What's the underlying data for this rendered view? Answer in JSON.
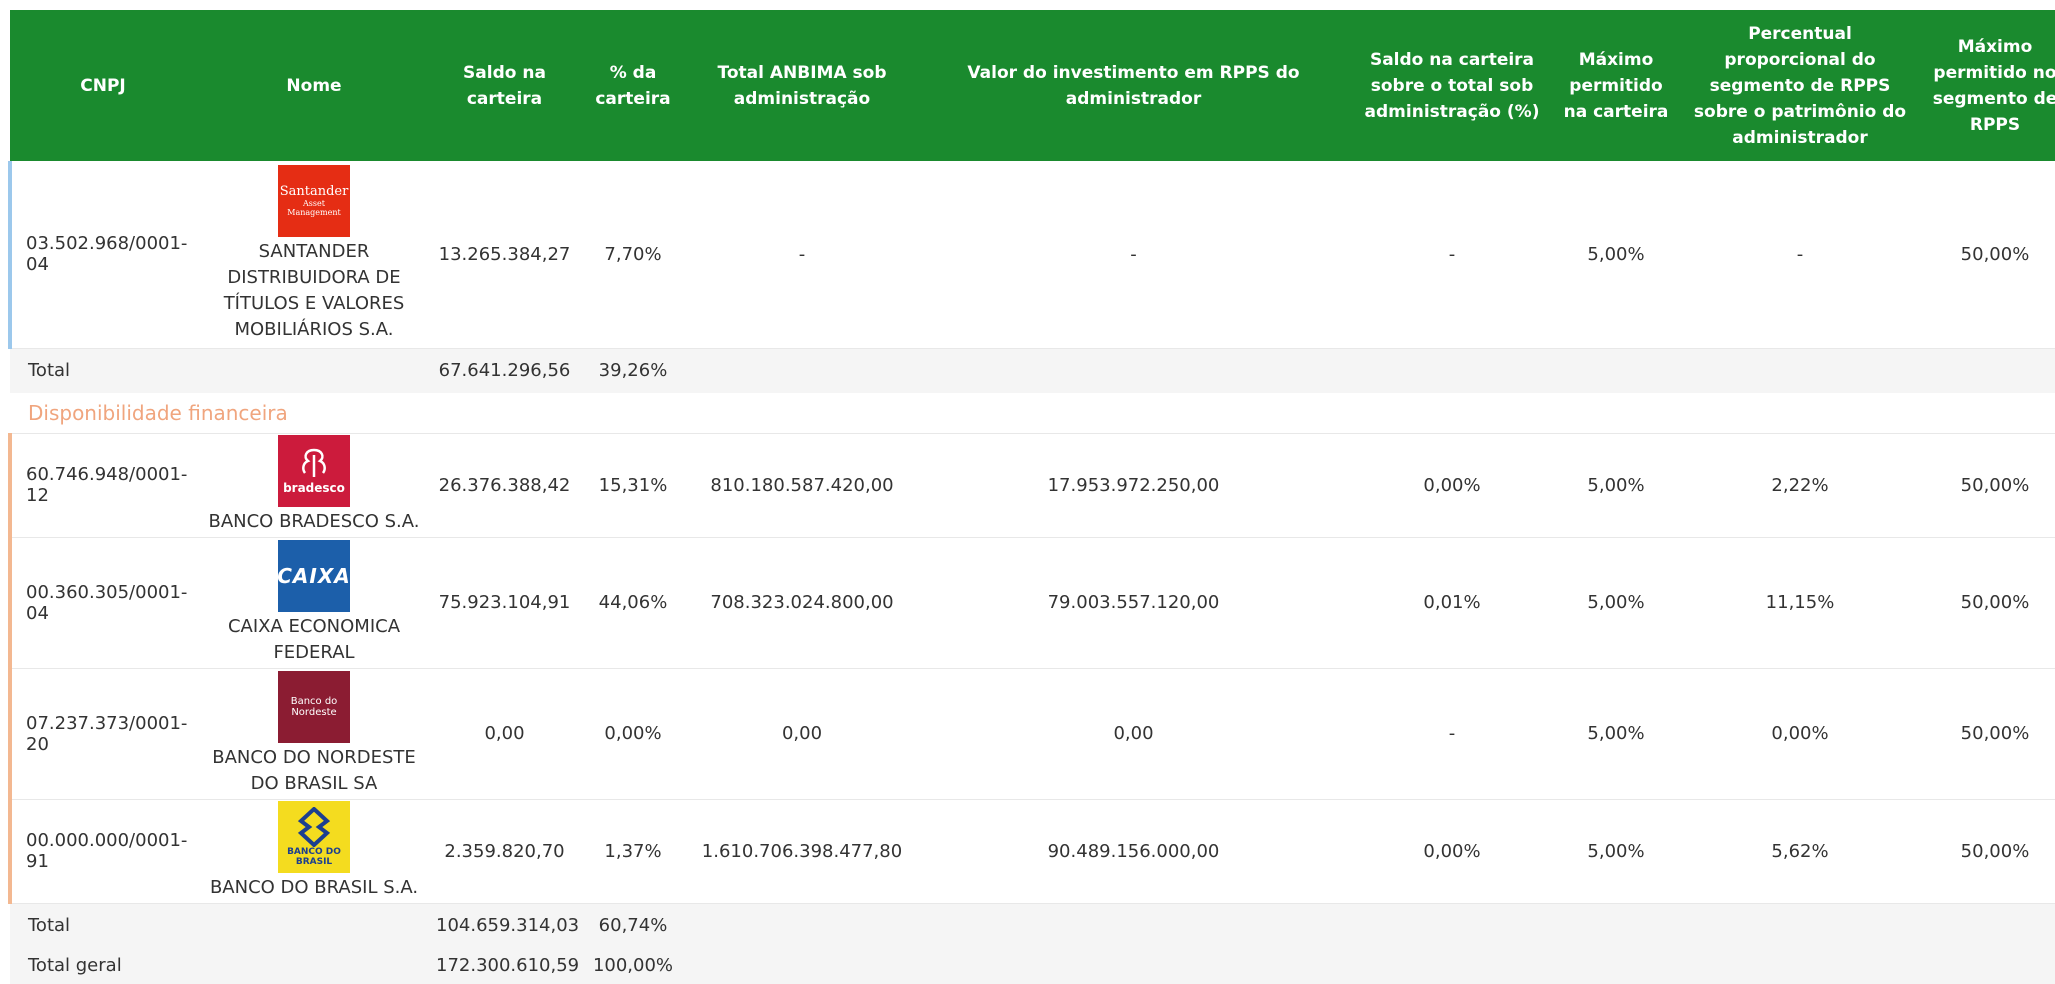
{
  "headers": [
    "CNPJ",
    "Nome",
    "Saldo na carteira",
    "% da carteira",
    "Total ANBIMA sob administração",
    "Valor do investimento em RPPS do administrador",
    "Saldo na carteira sobre o total sob administração (%)",
    "Máximo permitido na carteira",
    "Percentual proporcional do segmento de RPPS sobre o patrimônio do administrador",
    "Máximo permitido no segmento de RPPS"
  ],
  "rows": {
    "santander": {
      "cnpj": "03.502.968/0001-04",
      "logo_text1": "Santander",
      "logo_text2": "Asset Management",
      "nome": "SANTANDER DISTRIBUIDORA DE TÍTULOS E VALORES MOBILIÁRIOS S.A.",
      "saldo": "13.265.384,27",
      "pct": "7,70%",
      "anbima": "-",
      "rpps": "-",
      "saldo_total": "-",
      "max": "5,00%",
      "perc_seg": "-",
      "max_seg": "50,00%"
    },
    "bradesco": {
      "cnpj": "60.746.948/0001-12",
      "logo_text1": "bradesco",
      "nome": "BANCO BRADESCO S.A.",
      "saldo": "26.376.388,42",
      "pct": "15,31%",
      "anbima": "810.180.587.420,00",
      "rpps": "17.953.972.250,00",
      "saldo_total": "0,00%",
      "max": "5,00%",
      "perc_seg": "2,22%",
      "max_seg": "50,00%"
    },
    "caixa": {
      "cnpj": "00.360.305/0001-04",
      "logo_text1": "CAIXA",
      "nome": "CAIXA ECONOMICA FEDERAL",
      "saldo": "75.923.104,91",
      "pct": "44,06%",
      "anbima": "708.323.024.800,00",
      "rpps": "79.003.557.120,00",
      "saldo_total": "0,01%",
      "max": "5,00%",
      "perc_seg": "11,15%",
      "max_seg": "50,00%"
    },
    "bnb": {
      "cnpj": "07.237.373/0001-20",
      "logo_text1": "Banco do",
      "logo_text2": "Nordeste",
      "nome": "BANCO DO NORDESTE DO BRASIL SA",
      "saldo": "0,00",
      "pct": "0,00%",
      "anbima": "0,00",
      "rpps": "0,00",
      "saldo_total": "-",
      "max": "5,00%",
      "perc_seg": "0,00%",
      "max_seg": "50,00%"
    },
    "bb": {
      "cnpj": "00.000.000/0001-91",
      "logo_text1": "BANCO DO BRASIL",
      "nome": "BANCO DO BRASIL S.A.",
      "saldo": "2.359.820,70",
      "pct": "1,37%",
      "anbima": "1.610.706.398.477,80",
      "rpps": "90.489.156.000,00",
      "saldo_total": "0,00%",
      "max": "5,00%",
      "perc_seg": "5,62%",
      "max_seg": "50,00%"
    }
  },
  "total1": {
    "label": "Total",
    "saldo": "67.641.296,56",
    "pct": "39,26%"
  },
  "section": {
    "label": "Disponibilidade financeira"
  },
  "total2": {
    "label": "Total",
    "saldo": "104.659.314,03",
    "pct": "60,74%"
  },
  "grand": {
    "label": "Total geral",
    "saldo": "172.300.610,59",
    "pct": "100,00%"
  },
  "colors": {
    "header_bg": "#1a8a2e",
    "section_text": "#f0a57e",
    "group1_bar": "#9cc8ec",
    "group2_bar": "#f3b891"
  }
}
